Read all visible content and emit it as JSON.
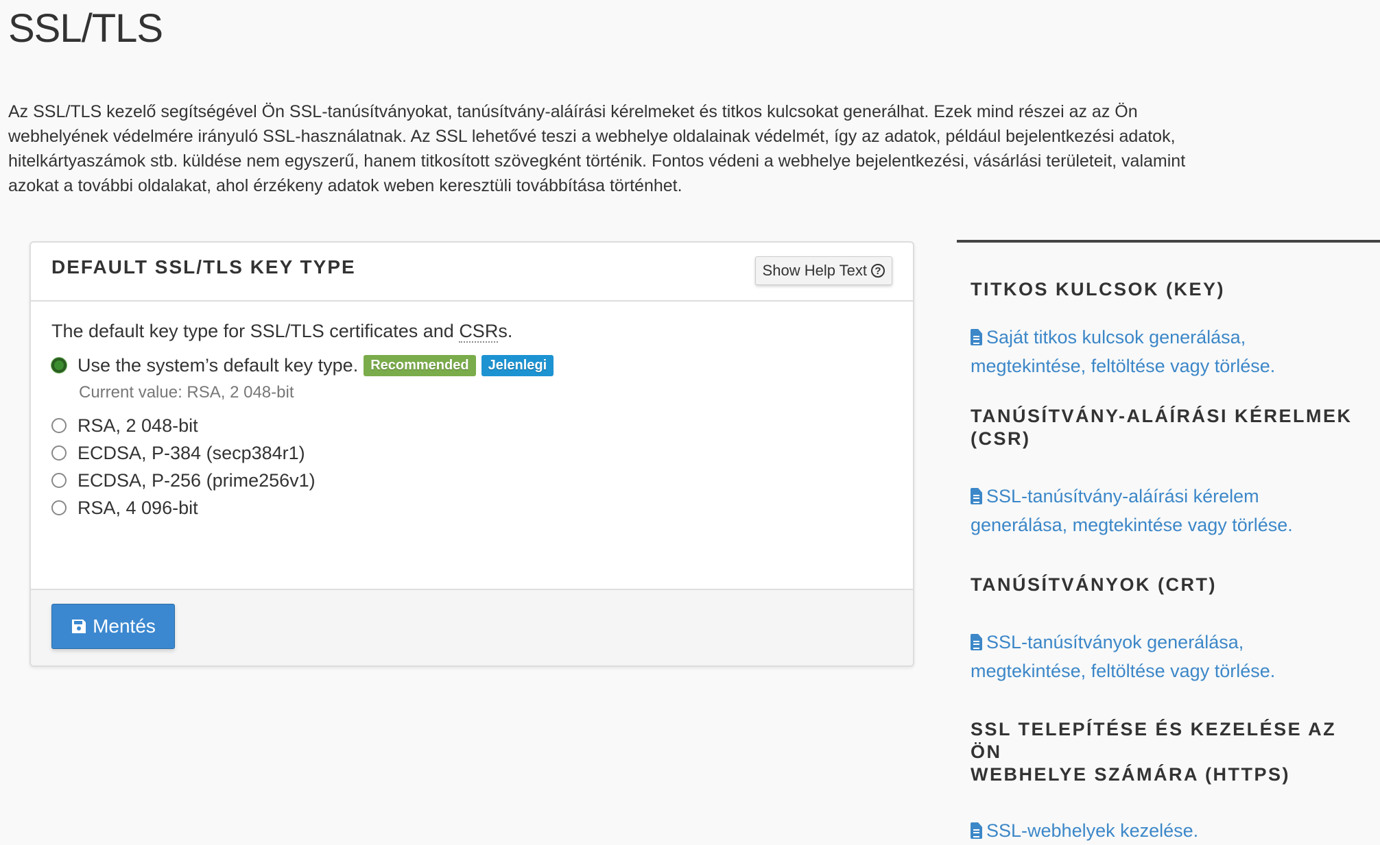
{
  "page": {
    "title": "SSL/TLS",
    "intro_lines": [
      "Az SSL/TLS kezelő segítségével Ön SSL-tanúsítványokat, tanúsítvány-aláírási kérelmeket és titkos kulcsokat generálhat. Ezek mind részei az az Ön",
      "webhelyének védelmére irányuló SSL-használatnak. Az SSL lehetővé teszi a webhelye oldalainak védelmét, így az adatok, például bejelentkezési adatok,",
      "hitelkártyaszámok stb. küldése nem egyszerű, hanem titkosított szövegként történik. Fontos védeni a webhelye bejelentkezési, vásárlási területeit, valamint",
      "azokat a további oldalakat, ahol érzékeny adatok weben keresztüli továbbítása történhet."
    ]
  },
  "panel": {
    "title": "DEFAULT SSL/TLS KEY TYPE",
    "help_button": {
      "label": "Show Help Text",
      "icon": "question-circle-icon"
    },
    "description_prefix": "The default key type for SSL/TLS certificates and ",
    "description_abbr": "CSR",
    "description_suffix": "s.",
    "options": [
      {
        "label": "Use the system’s default key type.",
        "checked": true
      },
      {
        "label": "RSA, 2 048-bit",
        "checked": false
      },
      {
        "label": "ECDSA, P-384 (secp384r1)",
        "checked": false
      },
      {
        "label": "ECDSA, P-256 (prime256v1)",
        "checked": false
      },
      {
        "label": "RSA, 4 096-bit",
        "checked": false
      }
    ],
    "badges": {
      "recommended": {
        "label": "Recommended",
        "color": "#7bac4b"
      },
      "current": {
        "label": "Jelenlegi",
        "color": "#1d93d2"
      }
    },
    "current_value": "Current value: RSA, 2 048-bit",
    "save_button": {
      "label": "Mentés",
      "icon": "floppy-disk-icon",
      "color": "#3b88d0"
    }
  },
  "sidebar": {
    "sections": [
      {
        "heading": "TITKOS KULCSOK (KEY)",
        "link_line1": "Saját titkos kulcsok generálása,",
        "link_line2": "megtekintése, feltöltése vagy törlése."
      },
      {
        "heading_line1": "TANÚSÍTVÁNY-ALÁÍRÁSI KÉRELMEK",
        "heading_line2": "(CSR)",
        "link_line1": "SSL-tanúsítvány-aláírási kérelem",
        "link_line2": "generálása, megtekintése vagy törlése."
      },
      {
        "heading": "TANÚSÍTVÁNYOK (CRT)",
        "link_line1": "SSL-tanúsítványok generálása,",
        "link_line2": "megtekintése, feltöltése vagy törlése."
      },
      {
        "heading_line1": "SSL TELEPÍTÉSE ÉS KEZELÉSE AZ ÖN",
        "heading_line2": "WEBHELYE SZÁMÁRA (HTTPS)",
        "link_line1": "SSL-webhelyek kezelése."
      }
    ],
    "link_color": "#3c87c8"
  }
}
